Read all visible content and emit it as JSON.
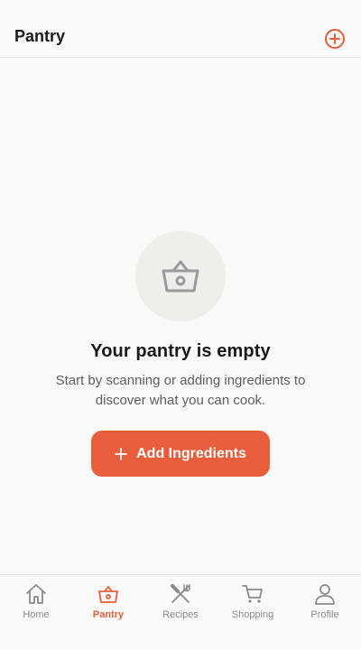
{
  "header": {
    "title": "Pantry",
    "add_icon": "plus-circle-icon"
  },
  "empty_state": {
    "icon": "basket-icon",
    "title": "Your pantry is empty",
    "subtitle": "Start by scanning or adding ingredients to discover what you can cook."
  },
  "cta": {
    "label": "Add Ingredients",
    "icon": "plus-icon"
  },
  "tabs": [
    {
      "label": "Home",
      "icon": "home-icon",
      "active": false
    },
    {
      "label": "Pantry",
      "icon": "basket-icon",
      "active": true
    },
    {
      "label": "Recipes",
      "icon": "utensils-icon",
      "active": false
    },
    {
      "label": "Shopping",
      "icon": "cart-icon",
      "active": false
    },
    {
      "label": "Profile",
      "icon": "user-icon",
      "active": false
    }
  ],
  "colors": {
    "accent": "#e85d3c",
    "background": "#f9f9f7",
    "muted": "#8a8a8a"
  }
}
